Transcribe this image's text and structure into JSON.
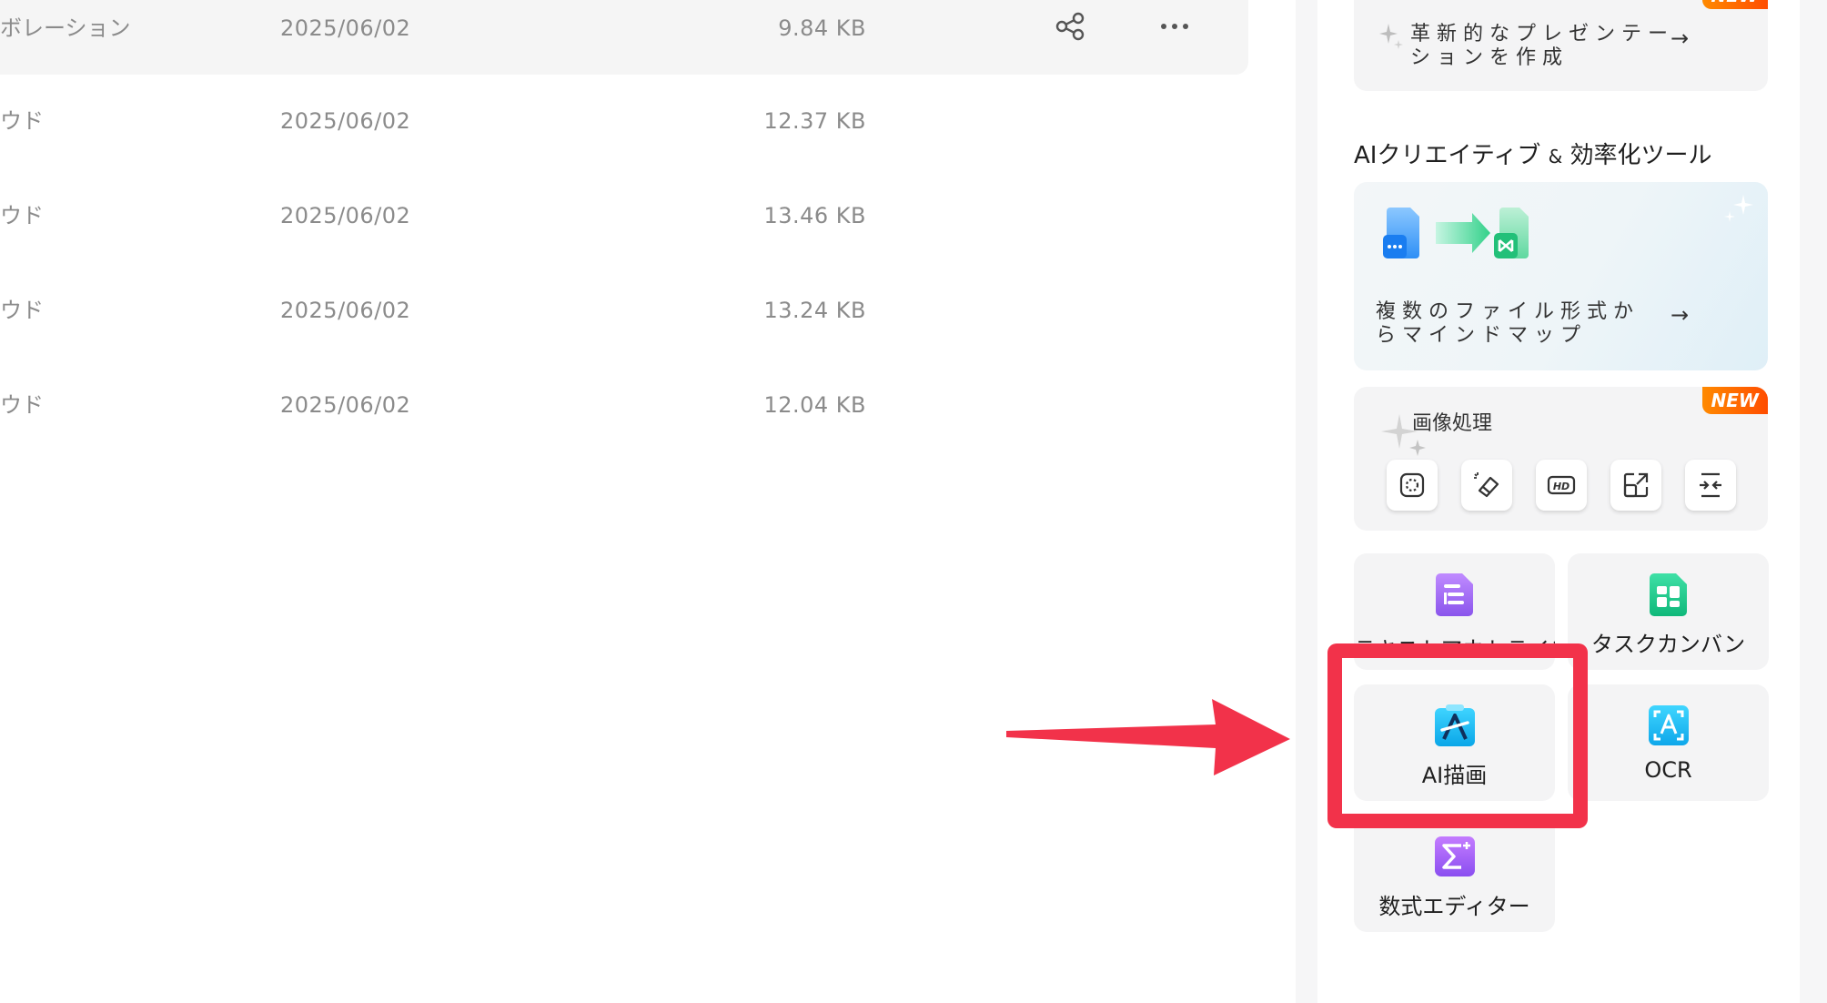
{
  "files": [
    {
      "name": "ボレーション",
      "date": "2025/06/02",
      "size": "9.84 KB",
      "selected": true
    },
    {
      "name": "ウド",
      "date": "2025/06/02",
      "size": "12.37 KB",
      "selected": false
    },
    {
      "name": "ウド",
      "date": "2025/06/02",
      "size": "13.46 KB",
      "selected": false
    },
    {
      "name": "ウド",
      "date": "2025/06/02",
      "size": "13.24 KB",
      "selected": false
    },
    {
      "name": "ウド",
      "date": "2025/06/02",
      "size": "12.04 KB",
      "selected": false
    }
  ],
  "row_actions": {
    "share_icon": "share-icon",
    "more_icon": "more-icon"
  },
  "panel": {
    "top_card": {
      "badge": "NEW",
      "text": "革新的なプレゼンテーションを作成",
      "arrow": "→"
    },
    "section_title_pre": "AIクリエイティブ",
    "section_title_amp": "&",
    "section_title_post": "効率化ツール",
    "convert_card": {
      "text": "複数のファイル形式からマインドマップ",
      "arrow": "→"
    },
    "image_card": {
      "title": "画像処理",
      "badge": "NEW",
      "tools": [
        "remove-background-icon",
        "eraser-icon",
        "hd-upscale-icon",
        "expand-image-icon",
        "compress-icon"
      ],
      "hd_text": "HD"
    },
    "apps": [
      {
        "label": "テキストアウトライン",
        "icon": "outline-icon"
      },
      {
        "label": "タスクカンバン",
        "icon": "kanban-icon"
      },
      {
        "label": "AI描画",
        "icon": "ai-drawing-icon"
      },
      {
        "label": "OCR",
        "icon": "ocr-icon"
      },
      {
        "label": "数式エディター",
        "icon": "formula-icon"
      }
    ]
  },
  "annotation": {
    "color": "#f2324a"
  },
  "colors": {
    "accent_new": "#ff6a00",
    "ai_draw": "#19b7f2",
    "kanban": "#17c58a",
    "outline": "#a06af2",
    "formula": "#9b5cf0"
  }
}
